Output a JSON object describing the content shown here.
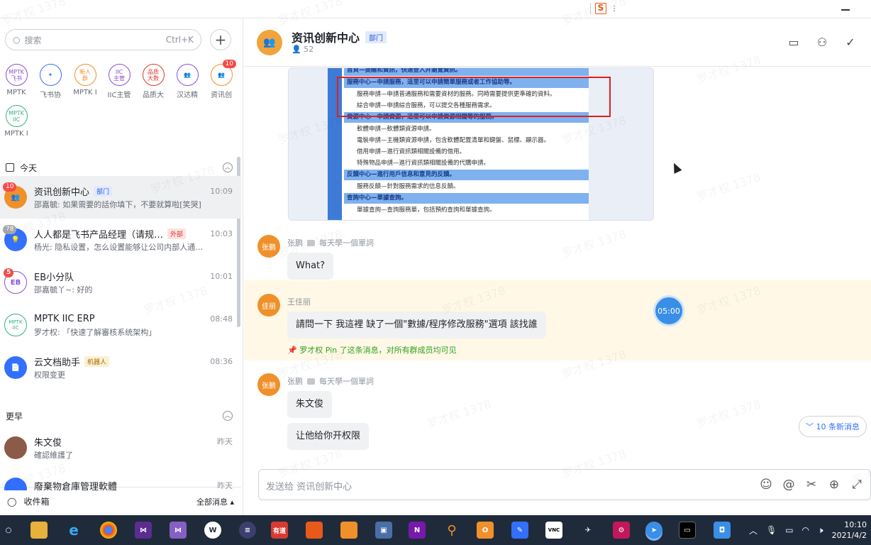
{
  "ime": {
    "logo": "S"
  },
  "search": {
    "placeholder": "搜索",
    "shortcut": "Ctrl+K"
  },
  "shortcuts": [
    {
      "top": "MPTK\n飞书",
      "label": "MPTK",
      "color": "#8a4fd6"
    },
    {
      "top": "✦",
      "label": "飞书协",
      "color": "#3370ff"
    },
    {
      "top": "新人\n群",
      "label": "MPTK I",
      "color": "#f0902a"
    },
    {
      "top": "IIC\n主管",
      "label": "IIC主管",
      "color": "#8a4fd6"
    },
    {
      "top": "品质\n大数",
      "label": "品质大",
      "color": "#d83931"
    },
    {
      "top": "👥",
      "label": "汉达精",
      "color": "#8a4fd6"
    },
    {
      "top": "👥",
      "label": "资讯创",
      "color": "#f0902a",
      "badge": "10"
    },
    {
      "top": "MPTK\nIIC",
      "label": "MPTK I",
      "color": "#34b27d"
    }
  ],
  "sections": {
    "today": "今天",
    "earlier": "更早"
  },
  "chats": [
    {
      "name": "资讯创新中心",
      "tag": "部门",
      "tag_type": "blue",
      "time": "10:09",
      "preview": "邵嘉毓: 如果需要的話你填下，不要就算啦[笑哭]",
      "badge": "10",
      "avatar": "👥",
      "avatar_color": "#f0902a",
      "active": true
    },
    {
      "name": "人人都是飞书产品经理（请规…",
      "tag": "外部",
      "tag_type": "red",
      "time": "10:03",
      "preview": "杨光: 隐私设置，怎么设置能够让公司内部人通…",
      "badge": "78",
      "badge_gray": true,
      "avatar": "💡",
      "avatar_color": "#3370ff"
    },
    {
      "name": "EB小分队",
      "tag": "",
      "time": "10:01",
      "preview": "邵嘉毓丫~: 好的",
      "badge": "5",
      "avatar": "EB",
      "avatar_color": "#8a4fd6"
    },
    {
      "name": "MPTK IIC ERP",
      "tag": "",
      "time": "08:48",
      "preview": "罗才权: 「快速了解審核系统架构」",
      "avatar": "MPTK IIC",
      "avatar_color": "#34b27d"
    },
    {
      "name": "云文档助手",
      "tag": "机器人",
      "tag_type": "yel",
      "time": "08:36",
      "preview": "权限变更",
      "avatar": "📄",
      "avatar_color": "#3370ff"
    },
    {
      "name": "朱文俊",
      "tag": "",
      "time": "昨天",
      "preview": "確認維護了",
      "avatar": "",
      "avatar_color": "#8c5a48"
    },
    {
      "name": "廢棄物倉庫管理軟體",
      "tag": "",
      "time": "昨天",
      "preview": "",
      "avatar": "",
      "avatar_color": "#3370ff"
    }
  ],
  "inbox": {
    "label": "收件箱",
    "filter": "全部消息 ▴"
  },
  "header": {
    "title": "资讯创新中心",
    "tag": "部门",
    "members": "52"
  },
  "doc_lines": [
    {
      "type": "h",
      "text": "首頁—提醒和資訊，快速登入并瀏覽資訊。"
    },
    {
      "type": "h",
      "text": "服務中心—申請服務，這里可以申請簡單服務或者工作協助等。"
    },
    {
      "type": "i",
      "text": "服務申請—申請普通服務和需要資材的服務。同時需要提供更準確的資料。"
    },
    {
      "type": "i",
      "text": "綜合申請—申請綜合服務，可以提交各種服務需求。"
    },
    {
      "type": "h",
      "text": "資源中心—申請資源，這里可以申請資源相關等的服務。"
    },
    {
      "type": "i",
      "text": "軟體申請—軟體類資源申請。"
    },
    {
      "type": "i",
      "text": "電裝申請—主機類資源申請，包含軟體配置清單和鍵盤、鼠標、顯示器。"
    },
    {
      "type": "i",
      "text": "借用申請—進行資訊類相關設備的借用。"
    },
    {
      "type": "i",
      "text": "特殊物品申請—進行資訊類相關設備的代購申請。"
    },
    {
      "type": "h",
      "text": "反饋中心—進行用戶信息和意見的反饋。"
    },
    {
      "type": "i",
      "text": "服務反饋—針對服務需求的信息反饋。"
    },
    {
      "type": "h",
      "text": "查詢中心—單據查詢。"
    },
    {
      "type": "i",
      "text": "單據查詢—查詢服務單，包括預約查詢和單據查詢。"
    }
  ],
  "messages": [
    {
      "sender": "张鹏",
      "avatar": "张鹏",
      "note": "每天學一個單詞",
      "bubbles": [
        "What?"
      ]
    },
    {
      "sender": "王佳丽",
      "avatar": "佳丽",
      "note": "",
      "bubbles": [
        "請問一下  我這裡  缺了一個\"數據/程序修改服務\"選項  該找誰"
      ],
      "pin": "📌 罗才权 Pin 了这条消息，对所有群成员均可见"
    },
    {
      "sender": "张鹏",
      "avatar": "张鹏",
      "note": "每天學一個單詞",
      "bubbles": [
        "朱文俊",
        "让他给你开权限"
      ]
    }
  ],
  "timer": "05:00",
  "new_messages": "﹀ 10 条新消息",
  "composer": {
    "placeholder": "发送给 资讯创新中心"
  },
  "clock": {
    "time": "10:10",
    "date": "2021/4/2"
  },
  "watermark": "罗才权 1378"
}
